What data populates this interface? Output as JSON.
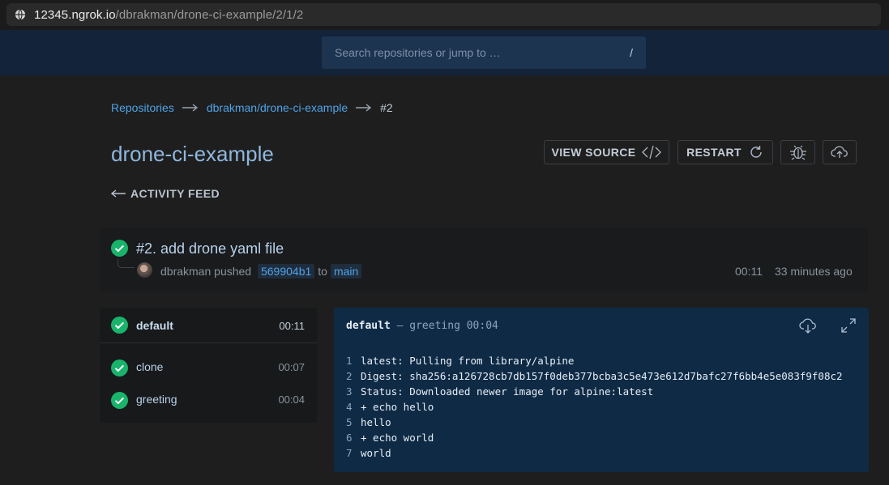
{
  "browser": {
    "url_host": "12345.ngrok.io",
    "url_path": "/dbrakman/drone-ci-example/2/1/2"
  },
  "header": {
    "search_placeholder": "Search repositories or jump to …",
    "search_shortcut": "/"
  },
  "breadcrumb": {
    "items": [
      "Repositories",
      "dbrakman/drone-ci-example"
    ],
    "current": "#2"
  },
  "page_title": "drone-ci-example",
  "actions": {
    "view_source": "VIEW SOURCE",
    "restart": "RESTART"
  },
  "activity_feed": "ACTIVITY FEED",
  "build": {
    "title": "#2. add drone yaml file",
    "author": "dbrakman",
    "action": "pushed",
    "commit": "569904b1",
    "to": "to",
    "branch": "main",
    "duration": "00:11",
    "ago": "33 minutes ago",
    "status_color": "#19b36b"
  },
  "stages": {
    "header": {
      "label": "default",
      "time": "00:11"
    },
    "steps": [
      {
        "label": "clone",
        "time": "00:07"
      },
      {
        "label": "greeting",
        "time": "00:04"
      }
    ]
  },
  "log": {
    "stage": "default",
    "separator": "—",
    "step": "greeting",
    "time": "00:04",
    "lines": [
      {
        "n": "1",
        "text": "latest: Pulling from library/alpine"
      },
      {
        "n": "2",
        "text": "Digest: sha256:a126728cb7db157f0deb377bcba3c5e473e612d7bafc27f6bb4e5e083f9f08c2"
      },
      {
        "n": "3",
        "text": "Status: Downloaded newer image for alpine:latest"
      },
      {
        "n": "4",
        "text": "+ echo hello"
      },
      {
        "n": "5",
        "text": "hello"
      },
      {
        "n": "6",
        "text": "+ echo world"
      },
      {
        "n": "7",
        "text": "world"
      }
    ]
  },
  "colors": {
    "accent": "#4fa3e8",
    "success": "#19b36b",
    "header_bg": "#132339",
    "log_bg": "#0f2a45"
  }
}
